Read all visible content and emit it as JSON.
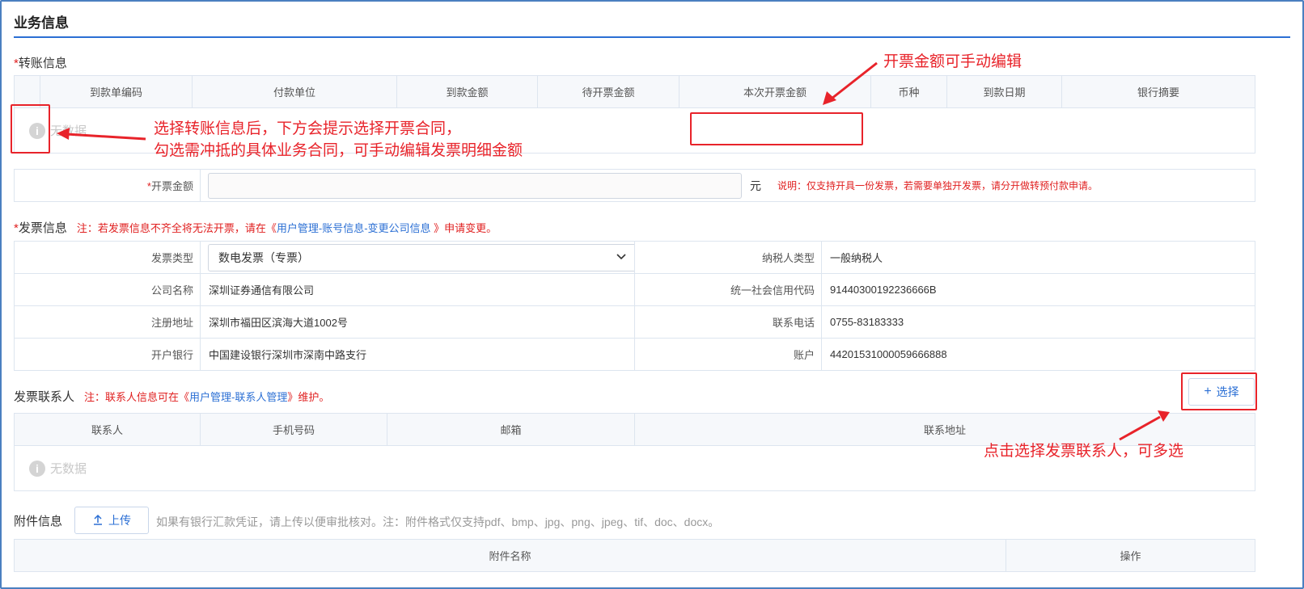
{
  "page_title": "业务信息",
  "transfer": {
    "required_mark": "*",
    "title": "转账信息",
    "columns": [
      "到款单编码",
      "付款单位",
      "到款金额",
      "待开票金额",
      "本次开票金额",
      "币种",
      "到款日期",
      "银行摘要"
    ],
    "empty_text": "无数据"
  },
  "amount_row": {
    "required_mark": "*",
    "label": "开票金额",
    "input_value": "",
    "unit": "元",
    "note": "说明：仅支持开具一份发票，若需要单独开发票，请分开做转预付款申请。"
  },
  "invoice": {
    "required_mark": "*",
    "title": "发票信息",
    "note_prefix": "注：若发票信息不齐全将无法开票，请在《",
    "note_link": "用户管理-账号信息-变更公司信息",
    "note_suffix": " 》申请变更。",
    "fields": {
      "type_label": "发票类型",
      "type_value": "数电发票（专票）",
      "taxpayer_label": "纳税人类型",
      "taxpayer_value": "一般纳税人",
      "company_label": "公司名称",
      "company_value": "深圳证券通信有限公司",
      "credit_label": "统一社会信用代码",
      "credit_value": "91440300192236666B",
      "address_label": "注册地址",
      "address_value": "深圳市福田区滨海大道1002号",
      "phone_label": "联系电话",
      "phone_value": "0755-83183333",
      "bank_label": "开户银行",
      "bank_value": "中国建设银行深圳市深南中路支行",
      "account_label": "账户",
      "account_value": "44201531000059666888"
    }
  },
  "contacts": {
    "title": "发票联系人",
    "note_prefix": "注：联系人信息可在《",
    "note_link": "用户管理-联系人管理",
    "note_suffix": "》维护。",
    "select_button": "选择",
    "columns": [
      "联系人",
      "手机号码",
      "邮箱",
      "联系地址"
    ],
    "empty_text": "无数据"
  },
  "attachments": {
    "title": "附件信息",
    "upload_button": "上传",
    "hint": "如果有银行汇款凭证，请上传以便审批核对。注：附件格式仅支持pdf、bmp、jpg、png、jpeg、tif、doc、docx。",
    "columns": [
      "附件名称",
      "操作"
    ]
  },
  "annotations": {
    "amount_edit": "开票金额可手动编辑",
    "select_transfer_line1": "选择转账信息后，下方会提示选择开票合同，",
    "select_transfer_line2": "勾选需冲抵的具体业务合同，可手动编辑发票明细金额",
    "select_contact": "点击选择发票联系人，可多选"
  },
  "colors": {
    "accent": "#2b6fd4",
    "annotation": "#e8232a",
    "required": "#e02020"
  }
}
